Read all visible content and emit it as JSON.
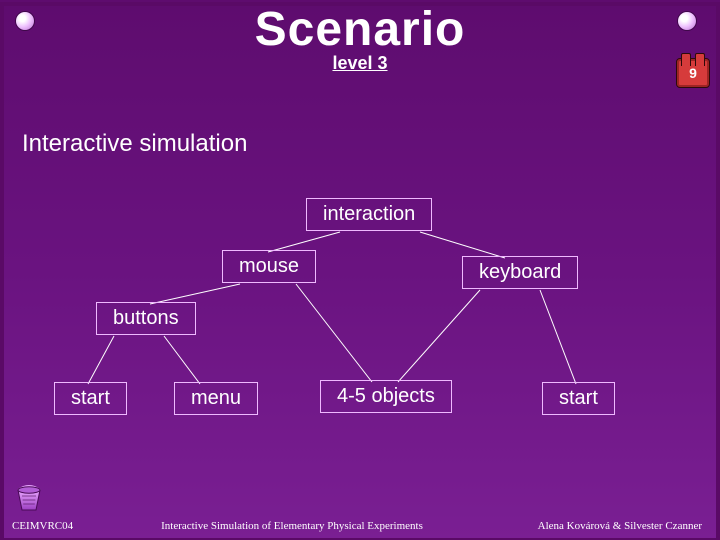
{
  "title": "Scenario",
  "subtitle": "level 3",
  "slide_number": "9",
  "section_heading": "Interactive simulation",
  "nodes": {
    "interaction": "interaction",
    "mouse": "mouse",
    "keyboard": "keyboard",
    "buttons": "buttons",
    "start1": "start",
    "menu": "menu",
    "objects": "4-5 objects",
    "start2": "start"
  },
  "footer": {
    "left": "CEIMVRC04",
    "center": "Interactive Simulation of Elementary Physical Experiments",
    "right": "Alena Kovárová & Silvester Czanner"
  },
  "colors": {
    "bg_top": "#5e0c6e",
    "bg_bottom": "#7a1f93",
    "node_border": "#efb9ff",
    "badge": "#d63b3b"
  }
}
